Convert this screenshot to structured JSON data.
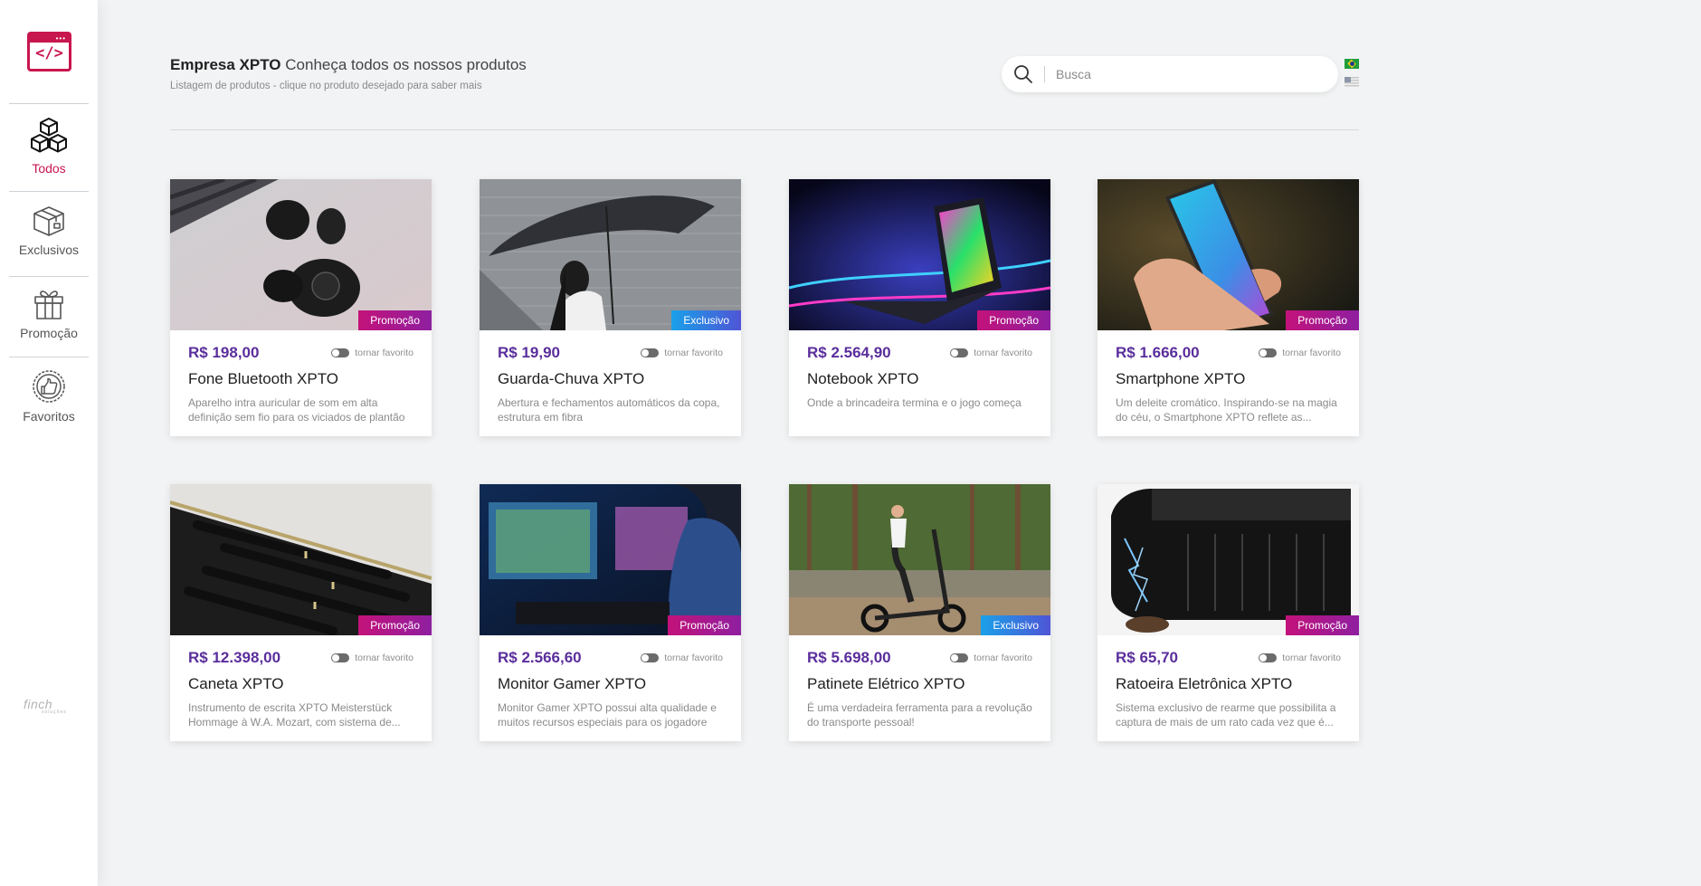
{
  "header": {
    "company": "Empresa XPTO",
    "tagline": "Conheça todos os nossos produtos",
    "subtitle": "Listagem de produtos - clique no produto desejado para saber mais"
  },
  "search": {
    "placeholder": "Busca",
    "value": ""
  },
  "languages": [
    "pt-BR",
    "en-US"
  ],
  "sidebar": {
    "items": [
      {
        "label": "Todos",
        "icon": "boxes-icon",
        "active": true
      },
      {
        "label": "Exclusivos",
        "icon": "open-box-icon",
        "active": false
      },
      {
        "label": "Promoção",
        "icon": "gift-icon",
        "active": false
      },
      {
        "label": "Favoritos",
        "icon": "thumbs-up-badge-icon",
        "active": false
      }
    ],
    "footer_brand": "finch",
    "footer_brand_sub": "soluções"
  },
  "favorite_label": "tornar favorito",
  "products": [
    {
      "name": "Fone Bluetooth XPTO",
      "price": "R$ 198,00",
      "badge": "Promoção",
      "description": "Aparelho intra auricular de som em alta definição sem fio para os viciados de plantão"
    },
    {
      "name": "Guarda-Chuva XPTO",
      "price": "R$ 19,90",
      "badge": "Exclusivo",
      "description": "Abertura e fechamentos automáticos da copa, estrutura em fibra"
    },
    {
      "name": "Notebook XPTO",
      "price": "R$ 2.564,90",
      "badge": "Promoção",
      "description": "Onde a brincadeira termina e o jogo começa"
    },
    {
      "name": "Smartphone XPTO",
      "price": "R$ 1.666,00",
      "badge": "Promoção",
      "description": "Um deleite cromático. Inspirando-se na magia do céu, o Smartphone XPTO reflete as..."
    },
    {
      "name": "Caneta XPTO",
      "price": "R$ 12.398,00",
      "badge": "Promoção",
      "description": "Instrumento de escrita XPTO Meisterstück Hommage à W.A. Mozart, com sistema de..."
    },
    {
      "name": "Monitor Gamer XPTO",
      "price": "R$ 2.566,60",
      "badge": "Promoção",
      "description": "Monitor Gamer XPTO possui alta qualidade e muitos recursos especiais para os jogadore"
    },
    {
      "name": "Patinete Elétrico XPTO",
      "price": "R$ 5.698,00",
      "badge": "Exclusivo",
      "description": "É uma verdadeira ferramenta para a revolução do transporte pessoal!"
    },
    {
      "name": "Ratoeira Eletrônica XPTO",
      "price": "R$ 65,70",
      "badge": "Promoção",
      "description": "Sistema exclusivo de rearme que possibilita a captura de mais de um rato cada vez que é..."
    }
  ],
  "colors": {
    "brand": "#c8164f",
    "price": "#5a2e9c",
    "promo_badge": "#b8167e",
    "exclusive_badge": "#2a8ee0"
  }
}
